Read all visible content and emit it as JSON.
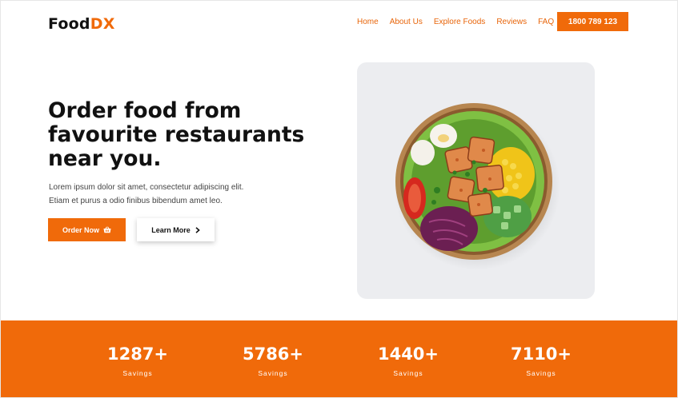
{
  "header": {
    "logo_main": "Food",
    "logo_accent": "DX",
    "nav": [
      "Home",
      "About Us",
      "Explore Foods",
      "Reviews",
      "FAQ"
    ],
    "phone": "1800 789 123"
  },
  "hero": {
    "title": "Order food from favourite restaurants near you.",
    "text_line1": "Lorem ipsum dolor sit amet, consectetur adipiscing elit.",
    "text_line2": "Etiam et purus a odio finibus bibendum amet leo.",
    "order_label": "Order Now",
    "learn_label": "Learn More"
  },
  "stats": [
    {
      "value": "1287+",
      "label": "Savings"
    },
    {
      "value": "5786+",
      "label": "Savings"
    },
    {
      "value": "1440+",
      "label": "Savings"
    },
    {
      "value": "7110+",
      "label": "Savings"
    }
  ],
  "colors": {
    "accent": "#f06a0a",
    "text": "#111111"
  }
}
